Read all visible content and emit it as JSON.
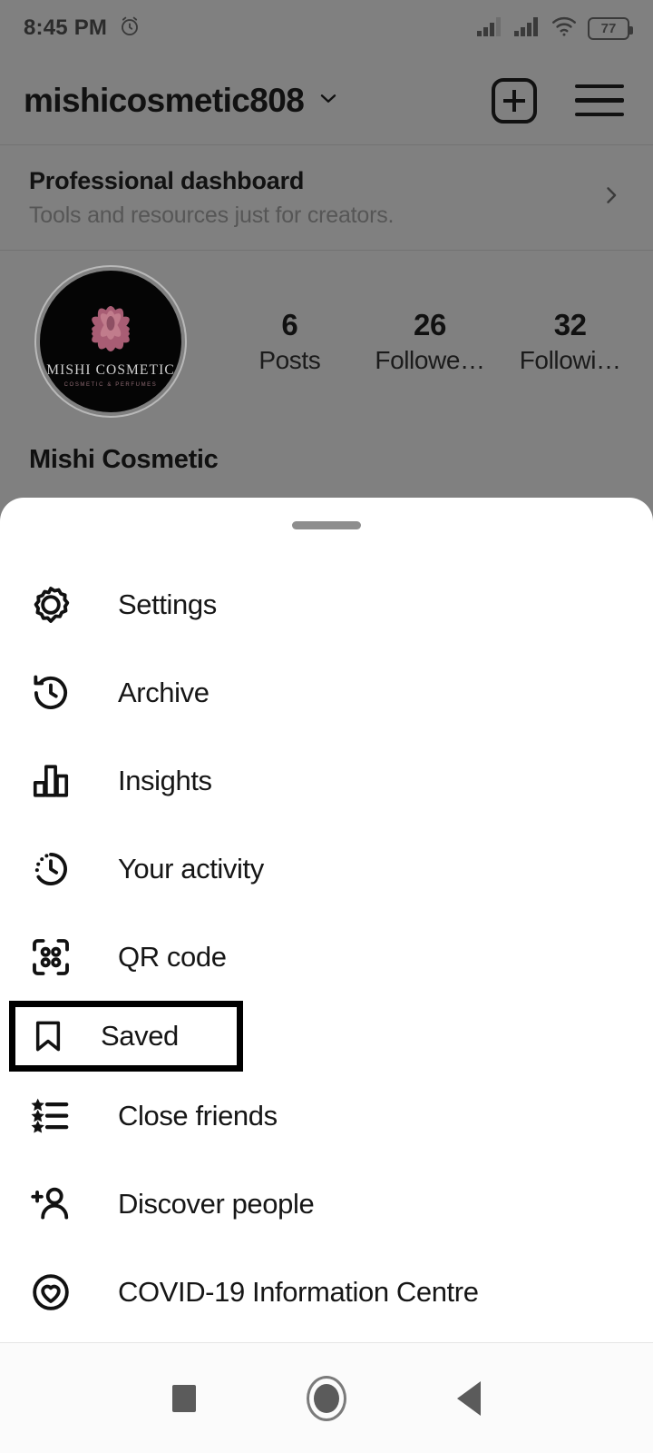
{
  "status_bar": {
    "time": "8:45 PM",
    "alarm_icon": "alarm-clock-icon",
    "signal_icon_1": "cellular-signal-icon",
    "signal_icon_2": "cellular-signal-icon",
    "wifi_icon": "wifi-icon",
    "battery_level": "77"
  },
  "header": {
    "username": "mishicosmetic808",
    "dropdown_icon": "chevron-down-icon",
    "create_icon": "plus-square-icon",
    "menu_icon": "hamburger-menu-icon"
  },
  "professional_dashboard": {
    "title": "Professional dashboard",
    "subtitle": "Tools and resources just for creators.",
    "chevron_icon": "chevron-right-icon"
  },
  "profile": {
    "avatar_icon": "profile-avatar",
    "avatar_brand": "MISHI COSMETIC",
    "avatar_tagline": "COSMETIC & PERFUMES",
    "full_name": "Mishi Cosmetic",
    "stats": [
      {
        "value": "6",
        "label": "Posts"
      },
      {
        "value": "26",
        "label": "Followe…"
      },
      {
        "value": "32",
        "label": "Followi…"
      }
    ]
  },
  "sheet": {
    "drag_handle": "drag-handle",
    "items": [
      {
        "label": "Settings",
        "icon": "gear-icon",
        "highlighted": false
      },
      {
        "label": "Archive",
        "icon": "archive-clock-icon",
        "highlighted": false
      },
      {
        "label": "Insights",
        "icon": "bar-chart-icon",
        "highlighted": false
      },
      {
        "label": "Your activity",
        "icon": "activity-clock-icon",
        "highlighted": false
      },
      {
        "label": "QR code",
        "icon": "qr-code-icon",
        "highlighted": false
      },
      {
        "label": "Saved",
        "icon": "bookmark-icon",
        "highlighted": true
      },
      {
        "label": "Close friends",
        "icon": "star-list-icon",
        "highlighted": false
      },
      {
        "label": "Discover people",
        "icon": "person-add-icon",
        "highlighted": false
      },
      {
        "label": "COVID-19 Information Centre",
        "icon": "heart-circle-icon",
        "highlighted": false
      }
    ]
  },
  "nav_bar": {
    "recents_icon": "square-recents-icon",
    "home_icon": "circle-home-icon",
    "back_icon": "triangle-back-icon"
  },
  "colors": {
    "backdrop": "#808080",
    "sheet": "#ffffff",
    "text": "#161616",
    "highlight_border": "#000000",
    "avatar_bg": "#050505",
    "avatar_flower": "#b8697f"
  }
}
